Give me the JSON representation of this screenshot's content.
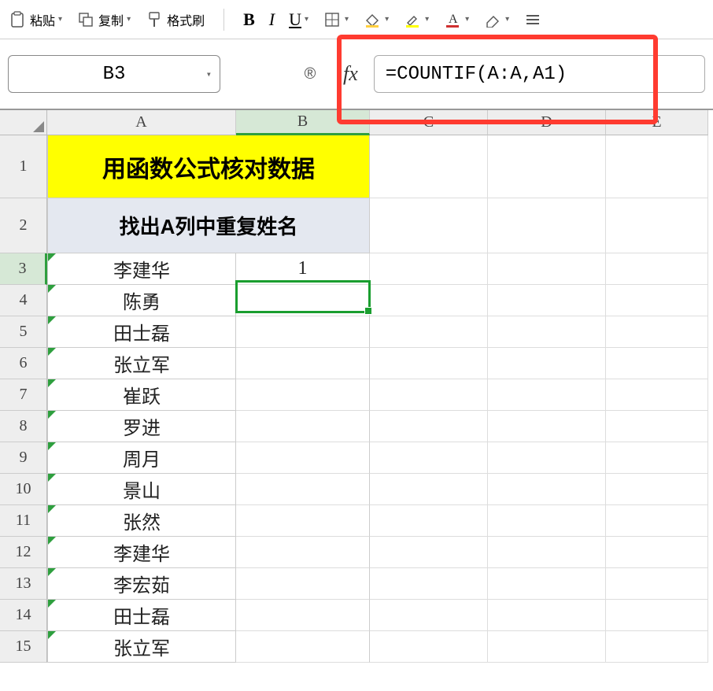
{
  "toolbar": {
    "paste_label": "粘贴",
    "copy_label": "复制",
    "format_painter_label": "格式刷"
  },
  "namebox": {
    "value": "B3"
  },
  "formula": {
    "value": "=COUNTIF(A:A,A1)"
  },
  "columns": [
    "A",
    "B",
    "C",
    "D",
    "E"
  ],
  "row_numbers": [
    "1",
    "2",
    "3",
    "4",
    "5",
    "6",
    "7",
    "8",
    "9",
    "10",
    "11",
    "12",
    "13",
    "14",
    "15"
  ],
  "cells": {
    "title": "用函数公式核对数据",
    "subtitle": "找出A列中重复姓名",
    "b3": "1",
    "names": [
      "李建华",
      "陈勇",
      "田士磊",
      "张立军",
      "崔跃",
      "罗进",
      "周月",
      "景山",
      "张然",
      "李建华",
      "李宏茹",
      "田士磊",
      "张立军"
    ]
  },
  "active_cell": "B3"
}
